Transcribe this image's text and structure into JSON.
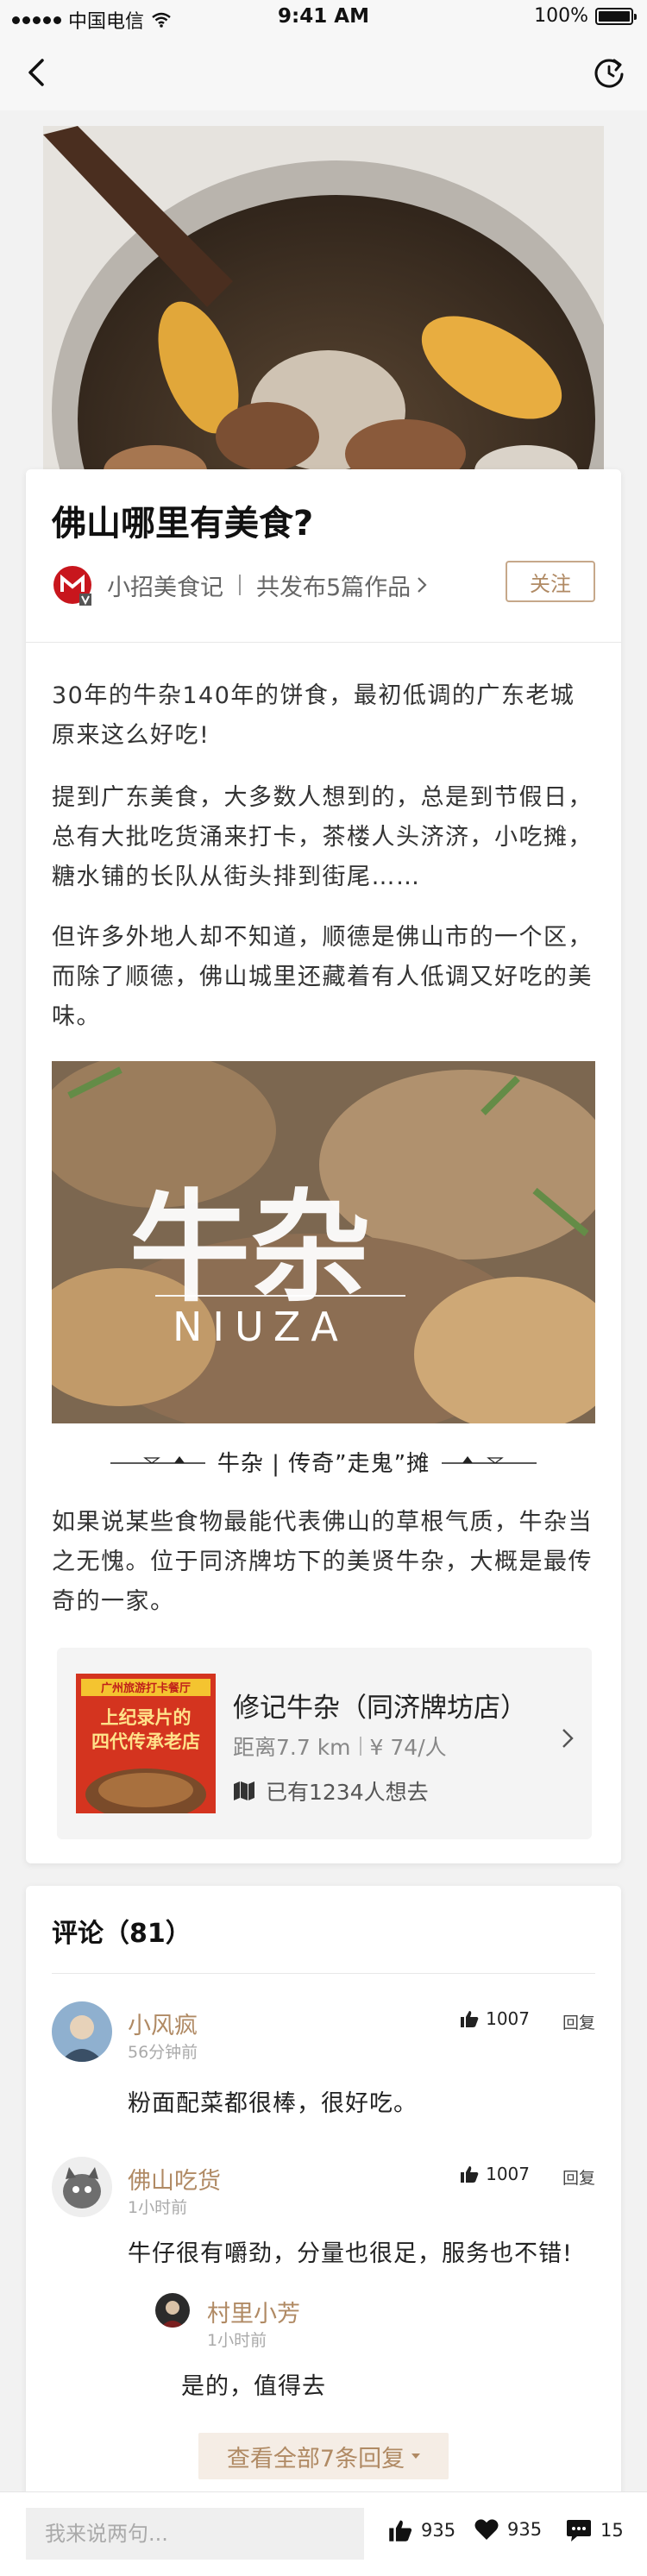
{
  "status_bar": {
    "carrier": "中国电信",
    "time": "9:41 AM",
    "battery": "100%",
    "battery_level": 1.0
  },
  "article": {
    "title": "佛山哪里有美食?",
    "author": "小招美食记",
    "works": "共发布5篇作品",
    "follow_label": "关注",
    "paragraphs": [
      "30年的牛杂140年的饼食，最初低调的广东老城原来这么好吃!",
      "提到广东美食，大多数人想到的，总是到节假日，总有大批吃货涌来打卡，茶楼人头济济，小吃摊，糖水铺的长队从街头排到街尾……",
      "但许多外地人却不知道，顺德是佛山市的一个区，而除了顺德，佛山城里还藏着有人低调又好吃的美味。",
      "如果说某些食物最能代表佛山的草根气质，牛杂当之无愧。位于同济牌坊下的美贤牛杂，大概是最传奇的一家。"
    ],
    "image_title": "牛杂",
    "image_subtitle": "NIUZA",
    "caption": "牛杂 | 传奇”走鬼”摊",
    "shop": {
      "name": "修记牛杂（同济牌坊店）",
      "distance": "距离7.7 km",
      "price": "¥ 74/人",
      "want": "已有1234人想去",
      "thumb_banner": "广州旅游打卡餐厅",
      "thumb_line1": "上纪录片的",
      "thumb_line2": "四代传承老店"
    }
  },
  "comments": {
    "title": "评论（81）",
    "items": [
      {
        "name": "小风疯",
        "time": "56分钟前",
        "likes": "1007",
        "reply_label": "回复",
        "text": "粉面配菜都很棒，很好吃。"
      },
      {
        "name": "佛山吃货",
        "time": "1小时前",
        "likes": "1007",
        "reply_label": "回复",
        "text": "牛仔很有嚼劲，分量也很足，服务也不错!",
        "reply": {
          "name": "村里小芳",
          "time": "1小时前",
          "text": "是的，值得去"
        }
      }
    ],
    "view_all": "查看全部7条回复"
  },
  "bottom_bar": {
    "input_placeholder": "我来说两句...",
    "likes": "935",
    "favorites": "935",
    "comments": "15"
  },
  "colors": {
    "accent": "#b08a64",
    "background": "#f2f2f2"
  },
  "icons": {
    "back": "back-icon",
    "refresh": "refresh-icon",
    "like": "thumb-up-icon",
    "favorite": "heart-icon",
    "comment": "comment-icon",
    "map": "map-icon"
  }
}
